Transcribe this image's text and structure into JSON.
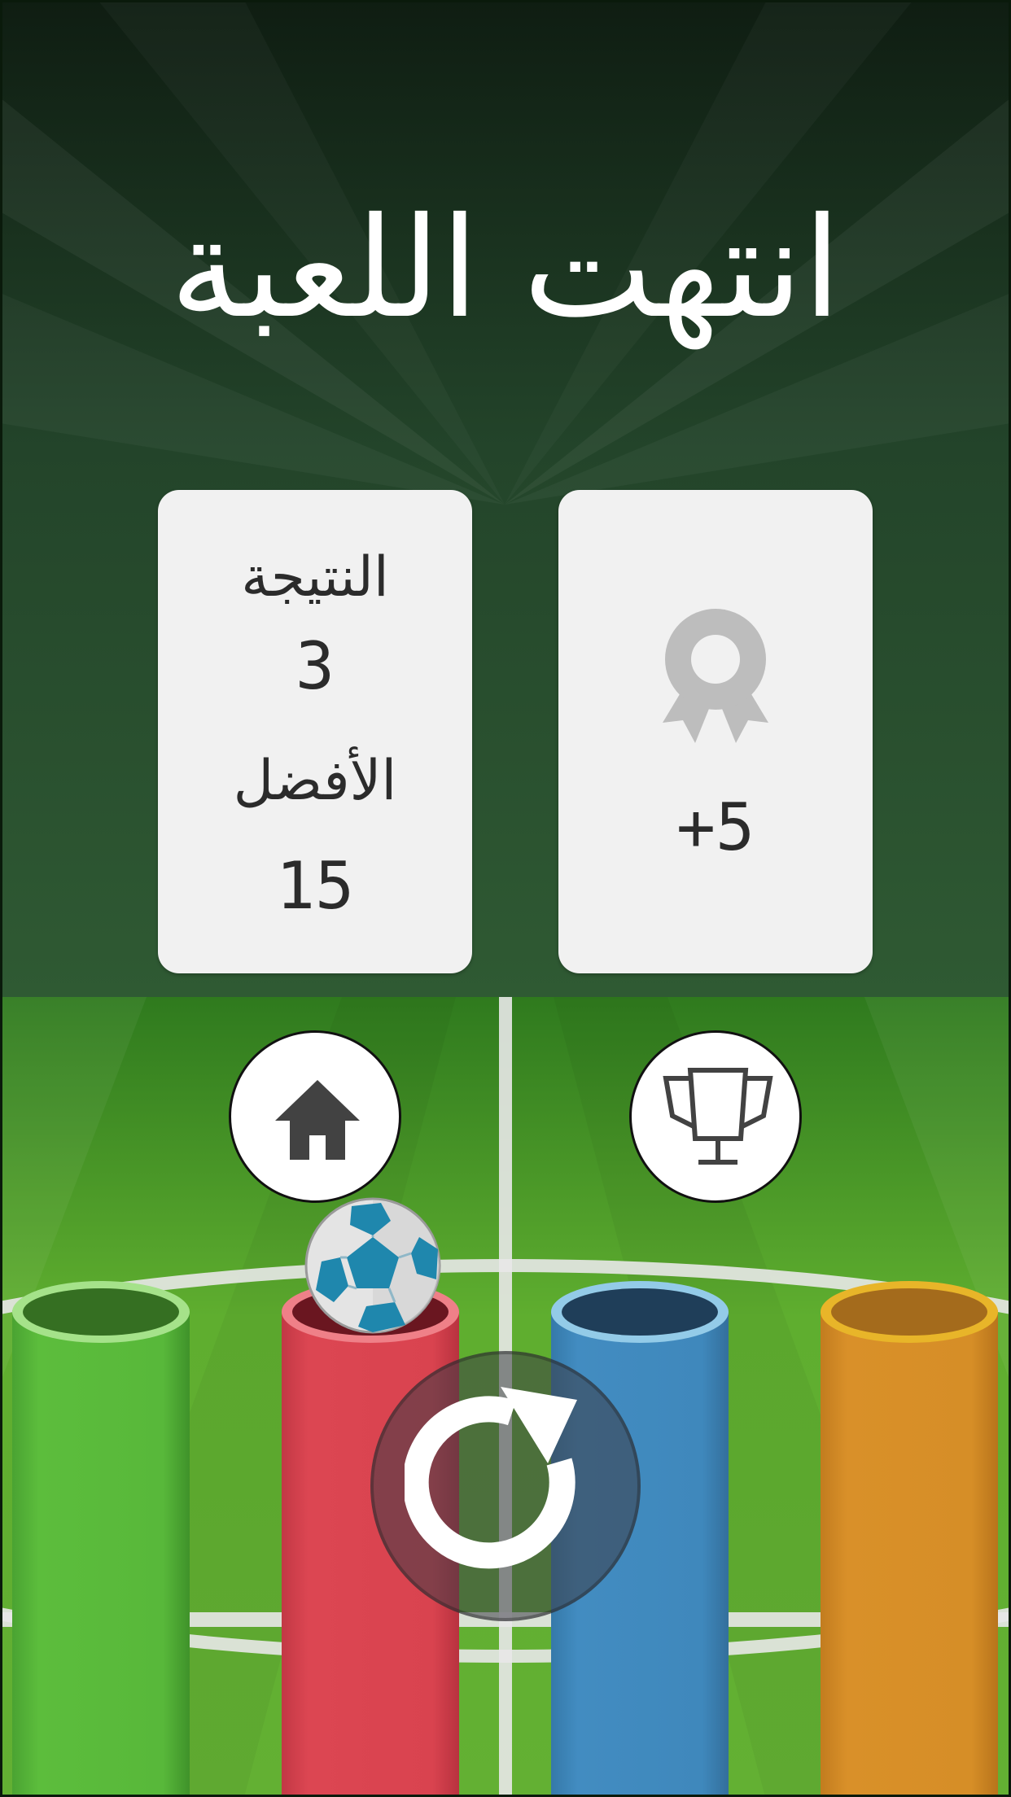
{
  "screen": {
    "title": "انتهت اللعبة"
  },
  "score_card": {
    "score_label": "النتيجة",
    "score_value": "3",
    "best_label": "الأفضل",
    "best_value": "15"
  },
  "reward_card": {
    "icon": "award-ribbon-icon",
    "reward_value": "+5"
  },
  "buttons": {
    "home_icon": "home-icon",
    "leaderboard_icon": "trophy-icon",
    "replay_icon": "replay-icon"
  },
  "tubes": [
    {
      "color": "green",
      "hex": "#57b83b"
    },
    {
      "color": "red",
      "hex": "#d9434f"
    },
    {
      "color": "blue",
      "hex": "#3f88bc"
    },
    {
      "color": "orange",
      "hex": "#d68e27"
    }
  ],
  "colors": {
    "card_bg": "#f1f1f1",
    "text_dark": "#2b2b2b",
    "icon_grey": "#bdbdbd",
    "field_green": "#5aa62e",
    "sky_dark": "#16331a"
  }
}
